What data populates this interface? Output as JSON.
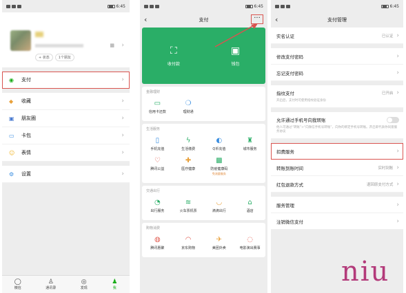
{
  "panel1": {
    "status_time": "6:45",
    "chips": [
      "+ 状态",
      "1个朋友"
    ],
    "menu": [
      {
        "label": "支付",
        "icon": "pay-icon"
      },
      {
        "label": "收藏",
        "icon": "favorites-icon"
      },
      {
        "label": "朋友圈",
        "icon": "moments-icon"
      },
      {
        "label": "卡包",
        "icon": "cards-icon"
      },
      {
        "label": "表情",
        "icon": "sticker-icon"
      },
      {
        "label": "设置",
        "icon": "settings-icon"
      }
    ],
    "tabs": [
      "微信",
      "通讯录",
      "发现",
      "我"
    ]
  },
  "panel2": {
    "status_time": "6:45",
    "title": "支付",
    "more": "···",
    "green": [
      {
        "label": "收付款"
      },
      {
        "label": "钱包"
      }
    ],
    "sections": [
      {
        "title": "金融理财",
        "items": [
          "信用卡还款",
          "理财通"
        ]
      },
      {
        "title": "生活服务",
        "items": [
          "手机充值",
          "生活缴费",
          "Q币充值",
          "城市服务",
          "腾讯公益",
          "医疗健康",
          "防疫健康码"
        ],
        "note": "免流量服务"
      },
      {
        "title": "交通出行",
        "items": [
          "出行服务",
          "火车票机票",
          "滴滴出行",
          "酒店"
        ]
      },
      {
        "title": "购物消费",
        "items": [
          "腾讯惠聚",
          "京东购物",
          "美团外卖",
          "电影演出赛事"
        ]
      }
    ]
  },
  "panel3": {
    "status_time": "6:45",
    "title": "支付管理",
    "rows1": [
      {
        "label": "实名认证",
        "value": "已认证"
      },
      {
        "label": "修改支付密码",
        "value": ""
      },
      {
        "label": "忘记支付密码",
        "value": ""
      }
    ],
    "fingerprint": {
      "label": "指纹支付",
      "value": "已开启",
      "desc": "开启后，支付时可使用指纹验证身份"
    },
    "phone_transfer": {
      "label": "允许通过手机号向我转账",
      "desc": "他人可通过“转账”>“向微信手机号转账”，向你的绑定手机号转账。开启即代表你同意服务协议"
    },
    "rows2": [
      {
        "label": "扣费服务",
        "value": ""
      },
      {
        "label": "转账到账时间",
        "value": "实时到账"
      },
      {
        "label": "红包退款方式",
        "value": "退回原支付方式"
      }
    ],
    "rows3": [
      {
        "label": "服务管理",
        "value": ""
      },
      {
        "label": "注销微信支付",
        "value": ""
      }
    ]
  },
  "watermark": "niu"
}
